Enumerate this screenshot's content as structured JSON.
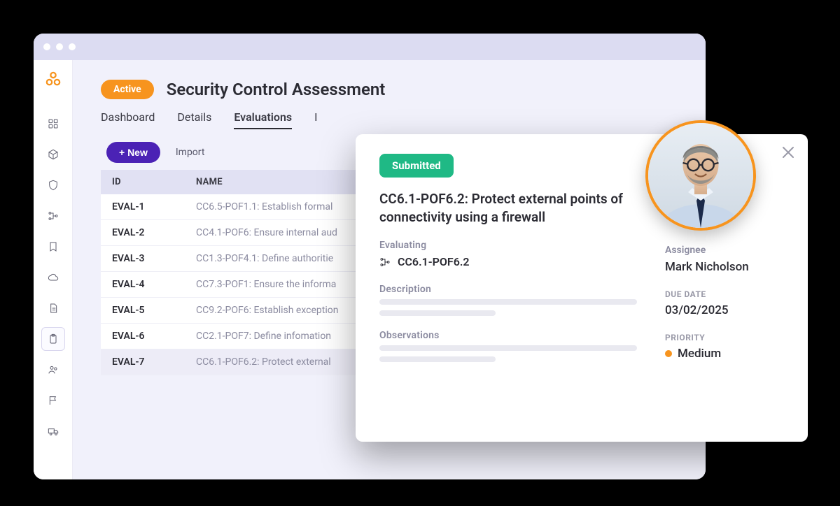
{
  "header": {
    "status_badge": "Active",
    "title": "Security Control Assessment"
  },
  "tabs": [
    {
      "label": "Dashboard",
      "active": false
    },
    {
      "label": "Details",
      "active": false
    },
    {
      "label": "Evaluations",
      "active": true
    },
    {
      "label": "I",
      "active": false
    }
  ],
  "toolbar": {
    "new_label": "+ New",
    "import_label": "Import"
  },
  "table": {
    "columns": {
      "id": "ID",
      "name": "NAME"
    },
    "rows": [
      {
        "id": "EVAL-1",
        "name": "CC6.5-POF1.1: Establish formal",
        "selected": false
      },
      {
        "id": "EVAL-2",
        "name": "CC4.1-POF6: Ensure internal aud",
        "selected": false
      },
      {
        "id": "EVAL-3",
        "name": "CC1.3-POF4.1: Define authoritie",
        "selected": false
      },
      {
        "id": "EVAL-4",
        "name": "CC7.3-POF1: Ensure the informa",
        "selected": false
      },
      {
        "id": "EVAL-5",
        "name": "CC9.2-POF6: Establish exception",
        "selected": false
      },
      {
        "id": "EVAL-6",
        "name": "CC2.1-POF7: Define infomation",
        "selected": false
      },
      {
        "id": "EVAL-7",
        "name": "CC6.1-POF6.2: Protect external",
        "selected": true
      }
    ]
  },
  "panel": {
    "status": "Submitted",
    "title": "CC6.1-POF6.2: Protect external points of connectivity using a firewall",
    "evaluating_label": "Evaluating",
    "evaluating_value": "CC6.1-POF6.2",
    "description_label": "Description",
    "observations_label": "Observations",
    "assignee_label": "Assignee",
    "assignee_value": "Mark Nicholson",
    "due_label": "DUE DATE",
    "due_value": "03/02/2025",
    "priority_label": "PRIORITY",
    "priority_value": "Medium",
    "priority_color": "#f7941e"
  },
  "sidebar_icons": [
    "dashboard-icon",
    "cube-icon",
    "shield-icon",
    "sitemap-icon",
    "bookmark-icon",
    "cloud-icon",
    "document-icon",
    "clipboard-icon",
    "users-icon",
    "flag-icon",
    "truck-icon"
  ],
  "colors": {
    "accent": "#f7941e",
    "primary_btn": "#4b22b5",
    "status_green": "#1fb985"
  }
}
